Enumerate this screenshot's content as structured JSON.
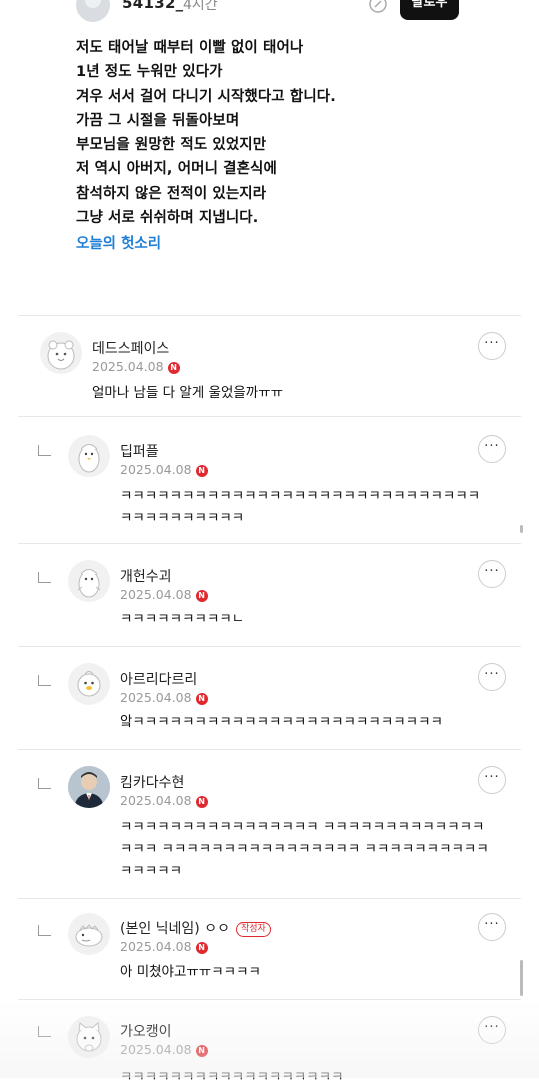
{
  "post": {
    "author": "54132_",
    "time": "4시간",
    "follow_label": "팔로우",
    "lines": [
      "저도 태어날 때부터 이빨 없이 태어나",
      "1년 정도 누워만 있다가",
      "겨우 서서 걸어 다니기 시작했다고 합니다.",
      "가끔 그 시절을 뒤돌아보며",
      "부모님을 원망한 적도 있었지만",
      "저 역시 아버지, 어머니 결혼식에",
      "참석하지 않은 전적이 있는지라",
      "그냥 서로 쉬쉬하며 지냅니다."
    ],
    "tag": "오늘의 헛소리"
  },
  "comments": [
    {
      "name": "데드스페이스",
      "date": "2025.04.08",
      "badge": "N",
      "text": "얼마나 남들 다 알게 울었을까ㅠㅠ",
      "reply": false,
      "avatar": "hamster-icon"
    },
    {
      "name": "딥퍼플",
      "date": "2025.04.08",
      "badge": "N",
      "text": "ㅋㅋㅋㅋㅋㅋㅋㅋㅋㅋㅋㅋㅋㅋㅋㅋㅋㅋㅋㅋㅋㅋㅋㅋㅋㅋㅋㅋㅋㅋㅋㅋㅋㅋㅋㅋㅋㅋㅋ",
      "reply": true,
      "avatar": "penguin-icon"
    },
    {
      "name": "개헌수괴",
      "date": "2025.04.08",
      "badge": "N",
      "text": "ㅋㅋㅋㅋㅋㅋㅋㅋㅋㄴ",
      "reply": true,
      "avatar": "penguin-icon"
    },
    {
      "name": "아르리다르리",
      "date": "2025.04.08",
      "badge": "N",
      "text": "앜ㅋㅋㅋㅋㅋㅋㅋㅋㅋㅋㅋㅋㅋㅋㅋㅋㅋㅋㅋㅋㅋㅋㅋㅋㅋ",
      "reply": true,
      "avatar": "chick-icon"
    },
    {
      "name": "킴카다수현",
      "date": "2025.04.08",
      "badge": "N",
      "text": "ㅋㅋㅋㅋㅋㅋㅋㅋㅋㅋㅋㅋㅋㅋㅋㅋ ㅋㅋㅋㅋㅋㅋㅋㅋㅋㅋㅋㅋㅋㅋㅋㅋ ㅋㅋㅋㅋㅋㅋㅋㅋㅋㅋㅋㅋㅋㅋㅋㅋ ㅋㅋㅋㅋㅋㅋㅋㅋㅋㅋㅋㅋㅋㅋㅋ",
      "reply": true,
      "avatar": "person-photo"
    },
    {
      "name": "(본인 닉네임) ㅇㅇ",
      "date": "2025.04.08",
      "badge": "N",
      "author_badge": "작성자",
      "text": "아 미쳤야고ㅠㅠㅋㅋㅋㅋ",
      "reply": true,
      "avatar": "dino-icon"
    },
    {
      "name": "가오캥이",
      "date": "2025.04.08",
      "badge": "N",
      "text": "ㅋㅋㅋㅋㅋㅋㅋㅋㅋㅋㅋㅋㅋㅋㅋㅋㅋㅋ",
      "reply": true,
      "avatar": "cat-icon"
    }
  ],
  "more_label": "···"
}
